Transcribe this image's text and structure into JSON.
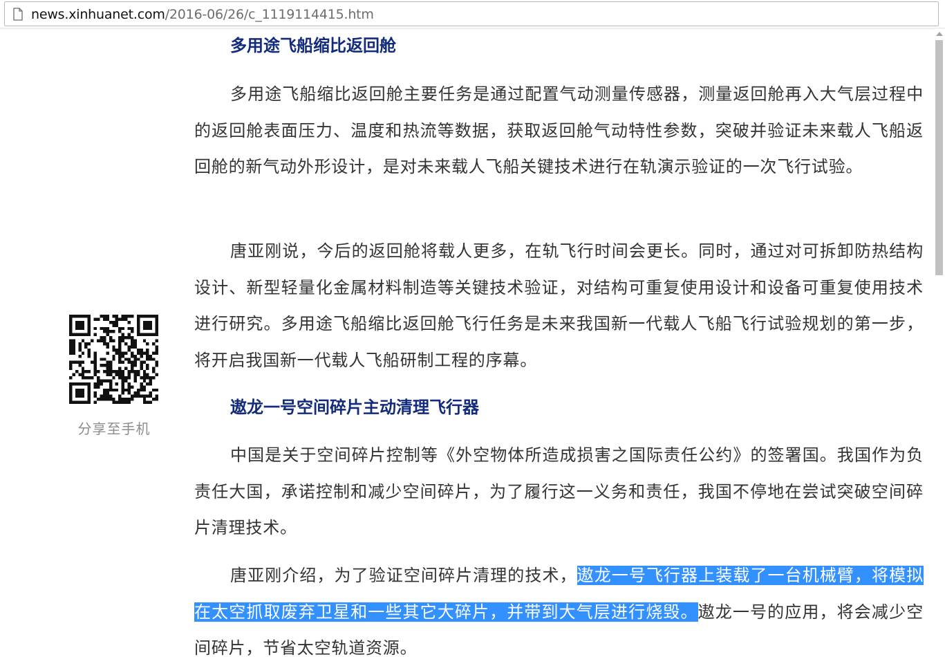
{
  "browser": {
    "url_host": "news.xinhuanet.com",
    "url_path": "/2016-06/26/c_1119114415.htm"
  },
  "share": {
    "label": "分享至手机"
  },
  "article": {
    "heading1": "多用途飞船缩比返回舱",
    "para1": "多用途飞船缩比返回舱主要任务是通过配置气动测量传感器，测量返回舱再入大气层过程中的返回舱表面压力、温度和热流等数据，获取返回舱气动特性参数，突破并验证未来载人飞船返回舱的新气动外形设计，是对未来载人飞船关键技术进行在轨演示验证的一次飞行试验。",
    "para2": "唐亚刚说，今后的返回舱将载人更多，在轨飞行时间会更长。同时，通过对可拆卸防热结构设计、新型轻量化金属材料制造等关键技术验证，对结构可重复使用设计和设备可重复使用技术进行研究。多用途飞船缩比返回舱飞行任务是未来我国新一代载人飞船飞行试验规划的第一步，将开启我国新一代载人飞船研制工程的序幕。",
    "heading2": "遨龙一号空间碎片主动清理飞行器",
    "para3": "中国是关于空间碎片控制等《外空物体所造成损害之国际责任公约》的签署国。我国作为负责任大国，承诺控制和减少空间碎片，为了履行这一义务和责任，我国不停地在尝试突破空间碎片清理技术。",
    "para4_before": "唐亚刚介绍，为了验证空间碎片清理的技术，",
    "para4_selected": "遨龙一号飞行器上装载了一台机械臂，将模拟在太空抓取废弃卫星和一些其它大碎片，并带到大气层进行烧毁。",
    "para4_after": "遨龙一号的应用，将会减少空间碎片，节省太空轨道资源。"
  },
  "colors": {
    "heading": "#132b7d",
    "body_text": "#333333",
    "selection": "#3390ff",
    "share_label": "#8c8c8c"
  }
}
